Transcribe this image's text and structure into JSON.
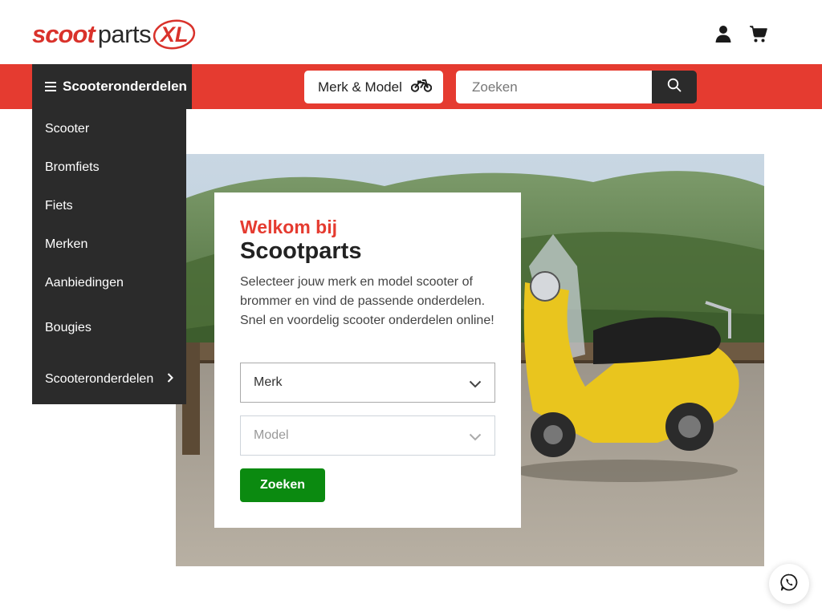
{
  "header": {
    "logo": {
      "part1": "scoot",
      "part2": "parts",
      "part3": "XL"
    },
    "user_icon": "user-icon",
    "cart_icon": "cart-icon"
  },
  "navbar": {
    "categories_label": "Scooteronderdelen",
    "merk_model_label": "Merk & Model",
    "search_placeholder": "Zoeken"
  },
  "menu": {
    "items": [
      "Scooter",
      "Bromfiets",
      "Fiets",
      "Merken",
      "Aanbiedingen",
      "Bougies",
      "Scooteronderdelen"
    ]
  },
  "hero": {
    "welcome": "Welkom bij",
    "brand": "Scootparts",
    "description": "Selecteer jouw merk en model scooter of brommer en vind de passende onderdelen. Snel en voordelig scooter onderdelen online!",
    "merk_placeholder": "Merk",
    "model_placeholder": "Model",
    "submit_label": "Zoeken"
  },
  "colors": {
    "accent_red": "#e53b30",
    "dark": "#2b2b2b",
    "submit_green": "#0b8a10"
  }
}
